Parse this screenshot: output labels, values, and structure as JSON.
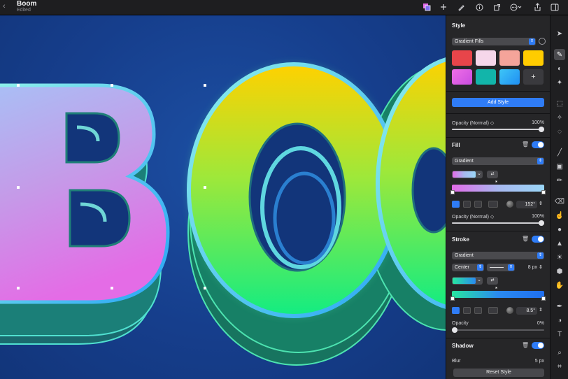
{
  "document": {
    "title": "Boom",
    "subtitle": "Edited",
    "back_glyph": "‹"
  },
  "toolbar": {
    "icons": [
      "color-swatch-icon",
      "plus-icon",
      "brush-icon",
      "info-icon",
      "resize-icon",
      "more-icon",
      "share-icon",
      "sidebar-icon"
    ]
  },
  "canvas": {
    "text": "BOO"
  },
  "style_panel": {
    "title": "Style",
    "preset": "Gradient Fills",
    "swatches": [
      "#e8454a",
      "#f6d7ea",
      "#f5a49a",
      "#ffcc00",
      "#e34fe2",
      "#12b5aa",
      "#2aa8f5",
      "#3a3a3e"
    ],
    "add_swatch_glyph": "+",
    "add_style_label": "Add Style",
    "opacity_label": "Opacity (Normal) ◇",
    "opacity_value": "100%",
    "opacity_fraction": 1.0
  },
  "fill": {
    "title": "Fill",
    "type": "Gradient",
    "angle": "152°",
    "opacity_label": "Opacity (Normal) ◇",
    "opacity_value": "100%",
    "opacity_fraction": 1.0,
    "gradient_colors": [
      "#e26be8",
      "#a8b8f0",
      "#9ad6f7"
    ]
  },
  "stroke": {
    "title": "Stroke",
    "type": "Gradient",
    "position": "Center",
    "width": "8 px",
    "angle": "8.5°",
    "opacity_label": "Opacity",
    "opacity_value": "0%",
    "opacity_fraction": 0.0,
    "gradient_colors": [
      "#27e6a0",
      "#2a8af0",
      "#1f6ff0"
    ]
  },
  "shadow": {
    "title": "Shadow",
    "blur_label": "Blur",
    "blur_value": "5 px"
  },
  "reset_label": "Reset Style",
  "tools": [
    "pointer-icon",
    "pen-select-icon",
    "fill-icon",
    "star-icon",
    "marquee-icon",
    "magic-wand-icon",
    "lasso-icon",
    "brush-icon",
    "bucket-icon",
    "pencil-icon",
    "eraser-icon",
    "smudge-icon",
    "blur-icon",
    "sharpen-icon",
    "sun-icon",
    "retouch-icon",
    "hand-icon",
    "pen-icon",
    "shape-icon",
    "text-icon",
    "zoom-icon",
    "crop-icon",
    "more-icon"
  ],
  "colors": {
    "accent": "#2f7cf6",
    "panel": "#262628",
    "canvas": "#163e8c"
  }
}
